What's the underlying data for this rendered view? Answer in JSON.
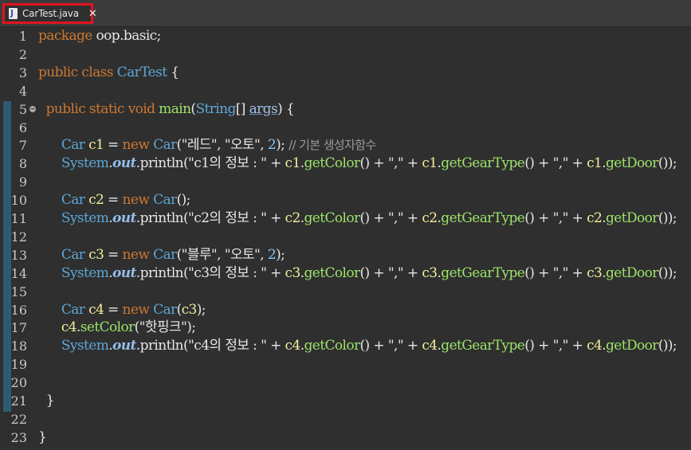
{
  "tab": {
    "label": "CarTest.java",
    "close": "✕",
    "icon": "java-file-icon"
  },
  "colors": {
    "background": "#2f2f2f",
    "keyword": "#cc7832",
    "type": "#5ca7d6",
    "variable": "#f0ee9a",
    "method": "#9de36a",
    "tab_highlight": "#e0141e"
  },
  "lines": [
    {
      "n": "1",
      "tokens": [
        [
          "kw",
          "package"
        ],
        [
          "plain",
          " oop.basic;"
        ]
      ]
    },
    {
      "n": "2",
      "tokens": []
    },
    {
      "n": "3",
      "tokens": [
        [
          "kw",
          "public class "
        ],
        [
          "type",
          "CarTest"
        ],
        [
          "plain",
          " {"
        ]
      ]
    },
    {
      "n": "4",
      "tokens": []
    },
    {
      "n": "5",
      "tokens": [
        [
          "plain",
          "  "
        ],
        [
          "kw",
          "public static void "
        ],
        [
          "fn",
          "main"
        ],
        [
          "plain",
          "("
        ],
        [
          "type",
          "String"
        ],
        [
          "plain",
          "[] "
        ],
        [
          "param",
          "args"
        ],
        [
          "plain",
          ") {"
        ]
      ]
    },
    {
      "n": "6",
      "tokens": []
    },
    {
      "n": "7",
      "tokens": [
        [
          "plain",
          "      "
        ],
        [
          "type",
          "Car "
        ],
        [
          "var",
          "c1"
        ],
        [
          "plain",
          " = "
        ],
        [
          "kw",
          "new "
        ],
        [
          "type",
          "Car"
        ],
        [
          "plain",
          "(\"레드\", \"오토\", "
        ],
        [
          "num",
          "2"
        ],
        [
          "plain",
          "); "
        ],
        [
          "cmt",
          "// 기본 생성자함수"
        ]
      ]
    },
    {
      "n": "8",
      "tokens": [
        [
          "plain",
          "      "
        ],
        [
          "type",
          "System"
        ],
        [
          "plain",
          "."
        ],
        [
          "field",
          "out"
        ],
        [
          "plain",
          "."
        ],
        [
          "plain",
          "println(\"c1의 정보 : \" + "
        ],
        [
          "var",
          "c1"
        ],
        [
          "plain",
          "."
        ],
        [
          "fn",
          "getColor"
        ],
        [
          "plain",
          "() + \",\" + "
        ],
        [
          "var",
          "c1"
        ],
        [
          "plain",
          "."
        ],
        [
          "fn",
          "getGearType"
        ],
        [
          "plain",
          "() + \",\" + "
        ],
        [
          "var",
          "c1"
        ],
        [
          "plain",
          "."
        ],
        [
          "fn",
          "getDoor"
        ],
        [
          "plain",
          "());"
        ]
      ]
    },
    {
      "n": "9",
      "tokens": []
    },
    {
      "n": "10",
      "tokens": [
        [
          "plain",
          "      "
        ],
        [
          "type",
          "Car "
        ],
        [
          "var",
          "c2"
        ],
        [
          "plain",
          " = "
        ],
        [
          "kw",
          "new "
        ],
        [
          "type",
          "Car"
        ],
        [
          "plain",
          "();"
        ]
      ]
    },
    {
      "n": "11",
      "tokens": [
        [
          "plain",
          "      "
        ],
        [
          "type",
          "System"
        ],
        [
          "plain",
          "."
        ],
        [
          "field",
          "out"
        ],
        [
          "plain",
          "."
        ],
        [
          "plain",
          "println(\"c2의 정보 : \" + "
        ],
        [
          "var",
          "c2"
        ],
        [
          "plain",
          "."
        ],
        [
          "fn",
          "getColor"
        ],
        [
          "plain",
          "() + \",\" + "
        ],
        [
          "var",
          "c2"
        ],
        [
          "plain",
          "."
        ],
        [
          "fn",
          "getGearType"
        ],
        [
          "plain",
          "() + \",\" + "
        ],
        [
          "var",
          "c2"
        ],
        [
          "plain",
          "."
        ],
        [
          "fn",
          "getDoor"
        ],
        [
          "plain",
          "());"
        ]
      ]
    },
    {
      "n": "12",
      "tokens": []
    },
    {
      "n": "13",
      "tokens": [
        [
          "plain",
          "      "
        ],
        [
          "type",
          "Car "
        ],
        [
          "var",
          "c3"
        ],
        [
          "plain",
          " = "
        ],
        [
          "kw",
          "new "
        ],
        [
          "type",
          "Car"
        ],
        [
          "plain",
          "(\"블루\", \"오토\", "
        ],
        [
          "num",
          "2"
        ],
        [
          "plain",
          ");"
        ]
      ]
    },
    {
      "n": "14",
      "tokens": [
        [
          "plain",
          "      "
        ],
        [
          "type",
          "System"
        ],
        [
          "plain",
          "."
        ],
        [
          "field",
          "out"
        ],
        [
          "plain",
          "."
        ],
        [
          "plain",
          "println(\"c3의 정보 : \" + "
        ],
        [
          "var",
          "c3"
        ],
        [
          "plain",
          "."
        ],
        [
          "fn",
          "getColor"
        ],
        [
          "plain",
          "() + \",\" + "
        ],
        [
          "var",
          "c3"
        ],
        [
          "plain",
          "."
        ],
        [
          "fn",
          "getGearType"
        ],
        [
          "plain",
          "() + \",\" + "
        ],
        [
          "var",
          "c3"
        ],
        [
          "plain",
          "."
        ],
        [
          "fn",
          "getDoor"
        ],
        [
          "plain",
          "());"
        ]
      ]
    },
    {
      "n": "15",
      "tokens": []
    },
    {
      "n": "16",
      "tokens": [
        [
          "plain",
          "      "
        ],
        [
          "type",
          "Car "
        ],
        [
          "var",
          "c4"
        ],
        [
          "plain",
          " = "
        ],
        [
          "kw",
          "new "
        ],
        [
          "type",
          "Car"
        ],
        [
          "plain",
          "("
        ],
        [
          "var",
          "c3"
        ],
        [
          "plain",
          ");"
        ]
      ]
    },
    {
      "n": "17",
      "tokens": [
        [
          "plain",
          "      "
        ],
        [
          "var",
          "c4"
        ],
        [
          "plain",
          "."
        ],
        [
          "fn",
          "setColor"
        ],
        [
          "plain",
          "(\"핫핑크\");"
        ]
      ]
    },
    {
      "n": "18",
      "tokens": [
        [
          "plain",
          "      "
        ],
        [
          "type",
          "System"
        ],
        [
          "plain",
          "."
        ],
        [
          "field",
          "out"
        ],
        [
          "plain",
          "."
        ],
        [
          "plain",
          "println(\"c4의 정보 : \" + "
        ],
        [
          "var",
          "c4"
        ],
        [
          "plain",
          "."
        ],
        [
          "fn",
          "getColor"
        ],
        [
          "plain",
          "() + \",\" + "
        ],
        [
          "var",
          "c4"
        ],
        [
          "plain",
          "."
        ],
        [
          "fn",
          "getGearType"
        ],
        [
          "plain",
          "() + \",\" + "
        ],
        [
          "var",
          "c4"
        ],
        [
          "plain",
          "."
        ],
        [
          "fn",
          "getDoor"
        ],
        [
          "plain",
          "());"
        ]
      ]
    },
    {
      "n": "19",
      "tokens": []
    },
    {
      "n": "20",
      "tokens": []
    },
    {
      "n": "21",
      "tokens": [
        [
          "plain",
          "  }"
        ]
      ]
    },
    {
      "n": "22",
      "tokens": []
    },
    {
      "n": "23",
      "tokens": [
        [
          "plain",
          "}"
        ]
      ]
    }
  ]
}
